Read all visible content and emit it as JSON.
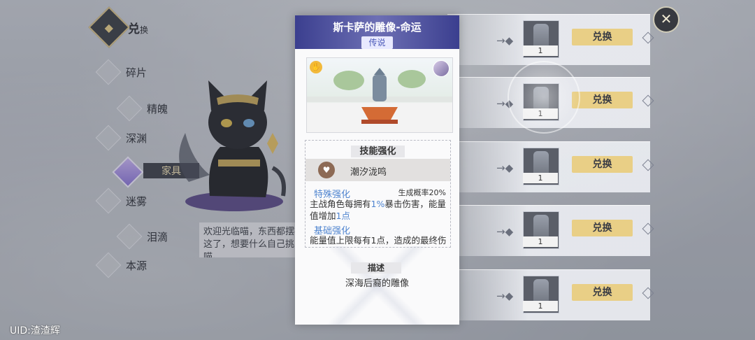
{
  "nav": {
    "header_title": "兑",
    "header_title_small": "换",
    "items": [
      {
        "label": "碎片"
      },
      {
        "label": "精魄"
      },
      {
        "label": "深渊"
      },
      {
        "label": "家具"
      },
      {
        "label": "迷雾"
      },
      {
        "label": "泪滴"
      },
      {
        "label": "本源"
      }
    ]
  },
  "greeting": "欢迎光临喵，东西都摆在这了，想要什么自己挑喵。",
  "uid": "UID:渣渣辉",
  "close_icon": "✕",
  "shop": {
    "rows": [
      {
        "qty": "1",
        "button": "兑换"
      },
      {
        "qty": "1",
        "button": "兑换"
      },
      {
        "qty": "1",
        "button": "兑换"
      },
      {
        "qty": "1",
        "button": "兑换"
      },
      {
        "qty": "1",
        "button": "兑换"
      }
    ]
  },
  "modal": {
    "title": "斯卡萨的雕像-命运",
    "rarity": "传说",
    "skill_section_label": "技能强化",
    "skill_name": "潮汐泷鸣",
    "special_title": "特殊强化",
    "special_prob": "生成概率20%",
    "special_desc_1": "主战角色每拥有",
    "special_desc_hl1": "1%",
    "special_desc_2": "暴击伤害，能量值增加",
    "special_desc_hl2": "1点",
    "basic_title": "基础强化",
    "basic_desc": "能量值上限每有1点，造成的最终伤",
    "desc_section_label": "描述",
    "desc_text": "深海后裔的雕像"
  }
}
